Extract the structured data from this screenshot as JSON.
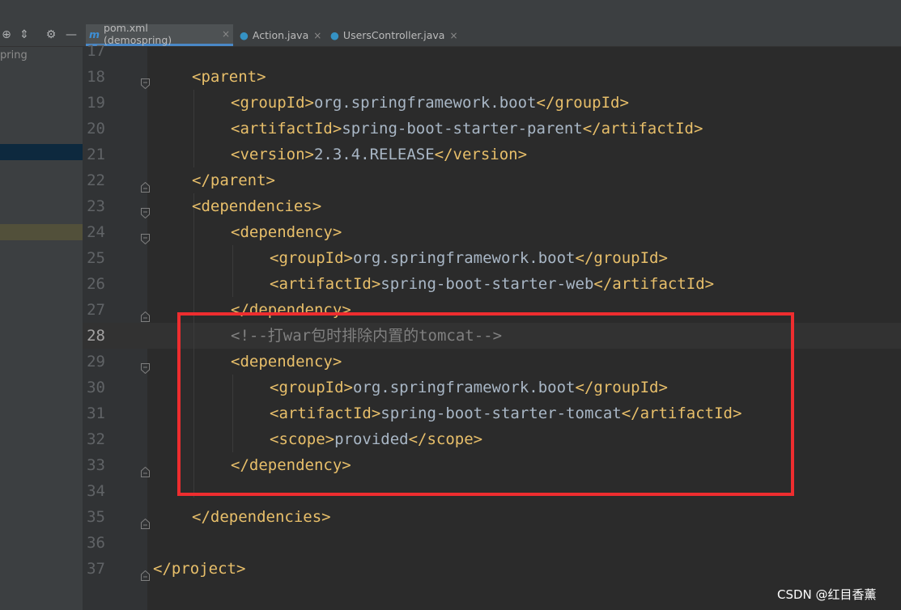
{
  "sidebar": {
    "tree_fragment": "pring",
    "tool_icons": [
      "crosshair-icon",
      "collapse-icon",
      "gear-icon",
      "minimize-icon"
    ]
  },
  "tabs": [
    {
      "icon": "maven-icon",
      "label": "pom.xml (demospring)",
      "active": true
    },
    {
      "icon": "java-class-icon",
      "label": "Action.java",
      "active": false
    },
    {
      "icon": "java-class-icon",
      "label": "UsersController.java",
      "active": false
    }
  ],
  "editor": {
    "current_line": "28",
    "lines": [
      {
        "n": "17",
        "parts": []
      },
      {
        "n": "18",
        "parts": [
          [
            "tag",
            "<parent>"
          ]
        ]
      },
      {
        "n": "19",
        "parts": [
          [
            "tag",
            "<groupId>"
          ],
          [
            "txt",
            "org.springframework.boot"
          ],
          [
            "tag",
            "</groupId>"
          ]
        ]
      },
      {
        "n": "20",
        "parts": [
          [
            "tag",
            "<artifactId>"
          ],
          [
            "txt",
            "spring-boot-starter-parent"
          ],
          [
            "tag",
            "</artifactId>"
          ]
        ]
      },
      {
        "n": "21",
        "parts": [
          [
            "tag",
            "<version>"
          ],
          [
            "txt",
            "2.3.4.RELEASE"
          ],
          [
            "tag",
            "</version>"
          ]
        ]
      },
      {
        "n": "22",
        "parts": [
          [
            "tag",
            "</parent>"
          ]
        ]
      },
      {
        "n": "23",
        "parts": [
          [
            "tag",
            "<dependencies>"
          ]
        ]
      },
      {
        "n": "24",
        "parts": [
          [
            "tag",
            "<dependency>"
          ]
        ]
      },
      {
        "n": "25",
        "parts": [
          [
            "tag",
            "<groupId>"
          ],
          [
            "txt",
            "org.springframework.boot"
          ],
          [
            "tag",
            "</groupId>"
          ]
        ]
      },
      {
        "n": "26",
        "parts": [
          [
            "tag",
            "<artifactId>"
          ],
          [
            "txt",
            "spring-boot-starter-web"
          ],
          [
            "tag",
            "</artifactId>"
          ]
        ]
      },
      {
        "n": "27",
        "parts": [
          [
            "tag",
            "</dependency>"
          ]
        ]
      },
      {
        "n": "28",
        "parts": [
          [
            "cmt",
            "<!--打war包时排除内置的tomcat-->"
          ]
        ]
      },
      {
        "n": "29",
        "parts": [
          [
            "tag",
            "<dependency>"
          ]
        ]
      },
      {
        "n": "30",
        "parts": [
          [
            "tag",
            "<groupId>"
          ],
          [
            "txt",
            "org.springframework.boot"
          ],
          [
            "tag",
            "</groupId>"
          ]
        ]
      },
      {
        "n": "31",
        "parts": [
          [
            "tag",
            "<artifactId>"
          ],
          [
            "txt",
            "spring-boot-starter-tomcat"
          ],
          [
            "tag",
            "</artifactId>"
          ]
        ]
      },
      {
        "n": "32",
        "parts": [
          [
            "tag",
            "<scope>"
          ],
          [
            "txt",
            "provided"
          ],
          [
            "tag",
            "</scope>"
          ]
        ]
      },
      {
        "n": "33",
        "parts": [
          [
            "tag",
            "</dependency>"
          ]
        ]
      },
      {
        "n": "34",
        "parts": []
      },
      {
        "n": "35",
        "parts": [
          [
            "tag",
            "</dependencies>"
          ]
        ]
      },
      {
        "n": "36",
        "parts": []
      },
      {
        "n": "37",
        "parts": [
          [
            "tag",
            "</project>"
          ]
        ]
      }
    ]
  },
  "watermark": "CSDN @红目香薰",
  "colors": {
    "tag": "#e8bf6a",
    "text": "#a9b7c6",
    "comment": "#808080",
    "highlight_box": "#ee2d2f",
    "tab_underline": "#4a88c7"
  }
}
